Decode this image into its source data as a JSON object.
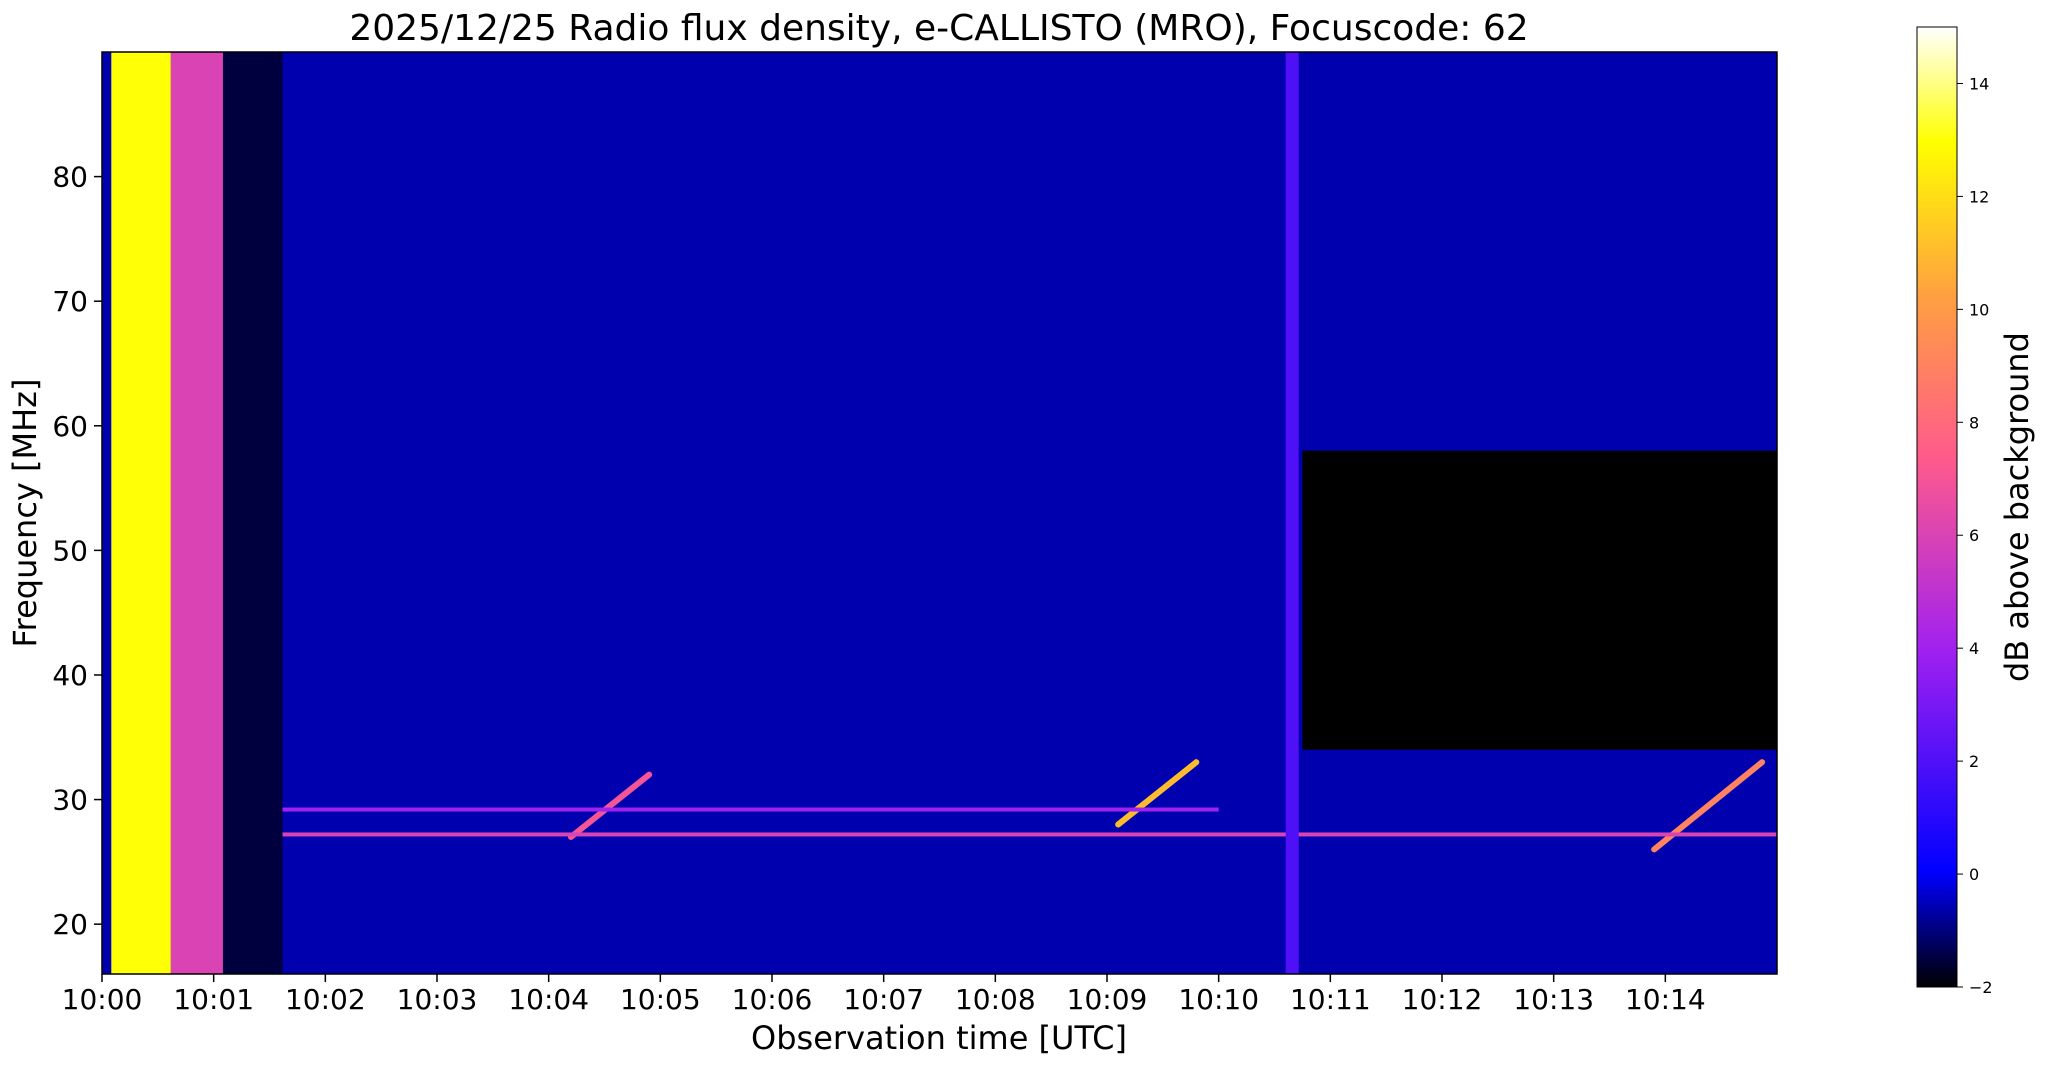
{
  "chart_data": {
    "type": "heatmap",
    "title": "2025/12/25  Radio flux density, e-CALLISTO (MRO), Focuscode: 62",
    "xlabel": "Observation time [UTC]",
    "ylabel": "Frequency [MHz]",
    "colorbar_label": "dB above background",
    "x_ticks": [
      "10:00",
      "10:01",
      "10:02",
      "10:03",
      "10:04",
      "10:05",
      "10:06",
      "10:07",
      "10:08",
      "10:09",
      "10:10",
      "10:11",
      "10:12",
      "10:13",
      "10:14"
    ],
    "xlim": [
      "10:00:00",
      "10:15:00"
    ],
    "y_ticks": [
      20,
      30,
      40,
      50,
      60,
      70,
      80
    ],
    "ylim": [
      16,
      90
    ],
    "colorbar_ticks": [
      -2,
      0,
      2,
      4,
      6,
      8,
      10,
      12,
      14
    ],
    "clim": [
      -2,
      15
    ],
    "colormap": "gnuplot2",
    "colormap_stops": [
      "#000000",
      "#0000ff",
      "#a020f0",
      "#ff5a8c",
      "#ffa040",
      "#ffff00",
      "#ffffff"
    ],
    "features": [
      {
        "kind": "saturation",
        "t_start": "10:00:05",
        "t_end": "10:00:37",
        "f_low": 16,
        "f_high": 90,
        "level_db": 13
      },
      {
        "kind": "calibration_band",
        "t_start": "10:00:37",
        "t_end": "10:01:05",
        "f_low": 16,
        "f_high": 90,
        "level_db": 6
      },
      {
        "kind": "calibration_band",
        "t_start": "10:01:05",
        "t_end": "10:01:37",
        "f_low": 16,
        "f_high": 90,
        "level_db": -1.5
      },
      {
        "kind": "fast_drift_burst",
        "t_start": "10:04:12",
        "t_end": "10:04:54",
        "f_low": 27,
        "f_high": 32,
        "level_db": 7
      },
      {
        "kind": "fast_drift_burst",
        "t_start": "10:09:06",
        "t_end": "10:09:48",
        "f_low": 28,
        "f_high": 33,
        "level_db": 11
      },
      {
        "kind": "fast_drift_burst",
        "t_start": "10:13:54",
        "t_end": "10:14:52",
        "f_low": 26,
        "f_high": 33,
        "level_db": 9
      },
      {
        "kind": "interference_line",
        "t_start": "10:01:37",
        "t_end": "10:15:00",
        "freq": 27.2,
        "level_db": 6
      },
      {
        "kind": "interference_line",
        "t_start": "10:01:37",
        "t_end": "10:10:00",
        "freq": 29.2,
        "level_db": 4
      },
      {
        "kind": "broadband_spike",
        "t_start": "10:10:36",
        "t_end": "10:10:43",
        "f_low": 16,
        "f_high": 90,
        "level_db": 2
      }
    ]
  }
}
